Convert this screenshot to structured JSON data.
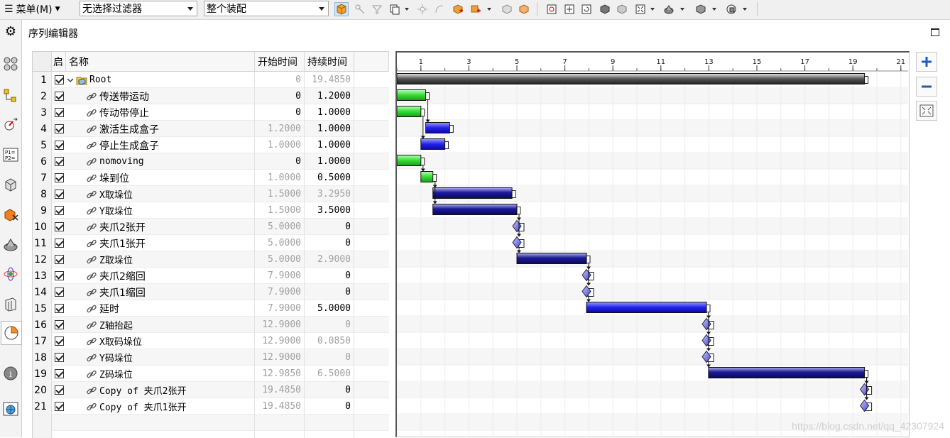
{
  "toolbar": {
    "menu_label": "菜单(M)",
    "filter_value": "无选择过滤器",
    "assembly_value": "整个装配"
  },
  "panel": {
    "title": "序列编辑器"
  },
  "table": {
    "headers": {
      "enable": "启",
      "name": "名称",
      "start": "开始时间",
      "duration": "持续时间"
    },
    "rows": [
      {
        "num": "1",
        "name": "Root",
        "start": "0",
        "duration": "19.4850",
        "start_dim": true,
        "duration_dim": true,
        "root": true
      },
      {
        "num": "2",
        "name": "传送带运动",
        "start": "0",
        "duration": "1.2000",
        "start_dim": false,
        "duration_dim": false
      },
      {
        "num": "3",
        "name": "传动带停止",
        "start": "0",
        "duration": "1.0000",
        "start_dim": false,
        "duration_dim": false
      },
      {
        "num": "4",
        "name": "激活生成盒子",
        "start": "1.2000",
        "duration": "1.0000",
        "start_dim": true,
        "duration_dim": false
      },
      {
        "num": "5",
        "name": "停止生成盒子",
        "start": "1.0000",
        "duration": "1.0000",
        "start_dim": true,
        "duration_dim": false
      },
      {
        "num": "6",
        "name": "nomoving",
        "start": "0",
        "duration": "1.0000",
        "start_dim": false,
        "duration_dim": false
      },
      {
        "num": "7",
        "name": "垛到位",
        "start": "1.0000",
        "duration": "0.5000",
        "start_dim": true,
        "duration_dim": false
      },
      {
        "num": "8",
        "name": "X取垛位",
        "start": "1.5000",
        "duration": "3.2950",
        "start_dim": true,
        "duration_dim": true
      },
      {
        "num": "9",
        "name": "Y取垛位",
        "start": "1.5000",
        "duration": "3.5000",
        "start_dim": true,
        "duration_dim": false
      },
      {
        "num": "10",
        "name": "夹爪2张开",
        "start": "5.0000",
        "duration": "0",
        "start_dim": true,
        "duration_dim": false
      },
      {
        "num": "11",
        "name": "夹爪1张开",
        "start": "5.0000",
        "duration": "0",
        "start_dim": true,
        "duration_dim": false
      },
      {
        "num": "12",
        "name": "Z取垛位",
        "start": "5.0000",
        "duration": "2.9000",
        "start_dim": true,
        "duration_dim": true
      },
      {
        "num": "13",
        "name": "夹爪2缩回",
        "start": "7.9000",
        "duration": "0",
        "start_dim": true,
        "duration_dim": false
      },
      {
        "num": "14",
        "name": "夹爪1缩回",
        "start": "7.9000",
        "duration": "0",
        "start_dim": true,
        "duration_dim": false
      },
      {
        "num": "15",
        "name": "延时",
        "start": "7.9000",
        "duration": "5.0000",
        "start_dim": true,
        "duration_dim": false
      },
      {
        "num": "16",
        "name": "Z轴抬起",
        "start": "12.9000",
        "duration": "0",
        "start_dim": true,
        "duration_dim": true
      },
      {
        "num": "17",
        "name": "X取码垛位",
        "start": "12.9000",
        "duration": "0.0850",
        "start_dim": true,
        "duration_dim": true
      },
      {
        "num": "18",
        "name": "Y码垛位",
        "start": "12.9000",
        "duration": "0",
        "start_dim": true,
        "duration_dim": true
      },
      {
        "num": "19",
        "name": "Z码垛位",
        "start": "12.9850",
        "duration": "6.5000",
        "start_dim": true,
        "duration_dim": true
      },
      {
        "num": "20",
        "name": "Copy of 夹爪2张开",
        "start": "19.4850",
        "duration": "0",
        "start_dim": true,
        "duration_dim": false
      },
      {
        "num": "21",
        "name": "Copy of 夹爪1张开",
        "start": "19.4850",
        "duration": "0",
        "start_dim": true,
        "duration_dim": false
      }
    ]
  },
  "gantt": {
    "ticks": [
      "1",
      "3",
      "5",
      "7",
      "9",
      "11",
      "13",
      "15",
      "17",
      "19",
      "21"
    ],
    "bars": [
      {
        "row": 1,
        "start": 0,
        "duration": 19.485,
        "kind": "root"
      },
      {
        "row": 2,
        "start": 0,
        "duration": 1.2,
        "kind": "green"
      },
      {
        "row": 3,
        "start": 0,
        "duration": 1.0,
        "kind": "green"
      },
      {
        "row": 4,
        "start": 1.2,
        "duration": 1.0,
        "kind": "blue"
      },
      {
        "row": 5,
        "start": 1.0,
        "duration": 1.0,
        "kind": "blue"
      },
      {
        "row": 6,
        "start": 0,
        "duration": 1.0,
        "kind": "green"
      },
      {
        "row": 7,
        "start": 1.0,
        "duration": 0.5,
        "kind": "green"
      },
      {
        "row": 8,
        "start": 1.5,
        "duration": 3.295,
        "kind": "navy"
      },
      {
        "row": 9,
        "start": 1.5,
        "duration": 3.5,
        "kind": "navy"
      },
      {
        "row": 10,
        "start": 5.0,
        "duration": 0,
        "kind": "milestone"
      },
      {
        "row": 11,
        "start": 5.0,
        "duration": 0,
        "kind": "milestone"
      },
      {
        "row": 12,
        "start": 5.0,
        "duration": 2.9,
        "kind": "navy"
      },
      {
        "row": 13,
        "start": 7.9,
        "duration": 0,
        "kind": "milestone"
      },
      {
        "row": 14,
        "start": 7.9,
        "duration": 0,
        "kind": "milestone"
      },
      {
        "row": 15,
        "start": 7.9,
        "duration": 5.0,
        "kind": "blue"
      },
      {
        "row": 16,
        "start": 12.9,
        "duration": 0,
        "kind": "milestone"
      },
      {
        "row": 17,
        "start": 12.9,
        "duration": 0.085,
        "kind": "milestone"
      },
      {
        "row": 18,
        "start": 12.9,
        "duration": 0,
        "kind": "milestone"
      },
      {
        "row": 19,
        "start": 12.985,
        "duration": 6.5,
        "kind": "navy"
      },
      {
        "row": 20,
        "start": 19.485,
        "duration": 0,
        "kind": "milestone"
      },
      {
        "row": 21,
        "start": 19.485,
        "duration": 0,
        "kind": "milestone"
      }
    ]
  },
  "colors": {
    "green_bar": "#33dd33",
    "blue_bar": "#2222ee",
    "navy_bar": "#1a1a99",
    "root_bar": "#555555",
    "milestone": "#4444cc"
  },
  "watermark": "https://blog.csdn.net/qq_42307924"
}
